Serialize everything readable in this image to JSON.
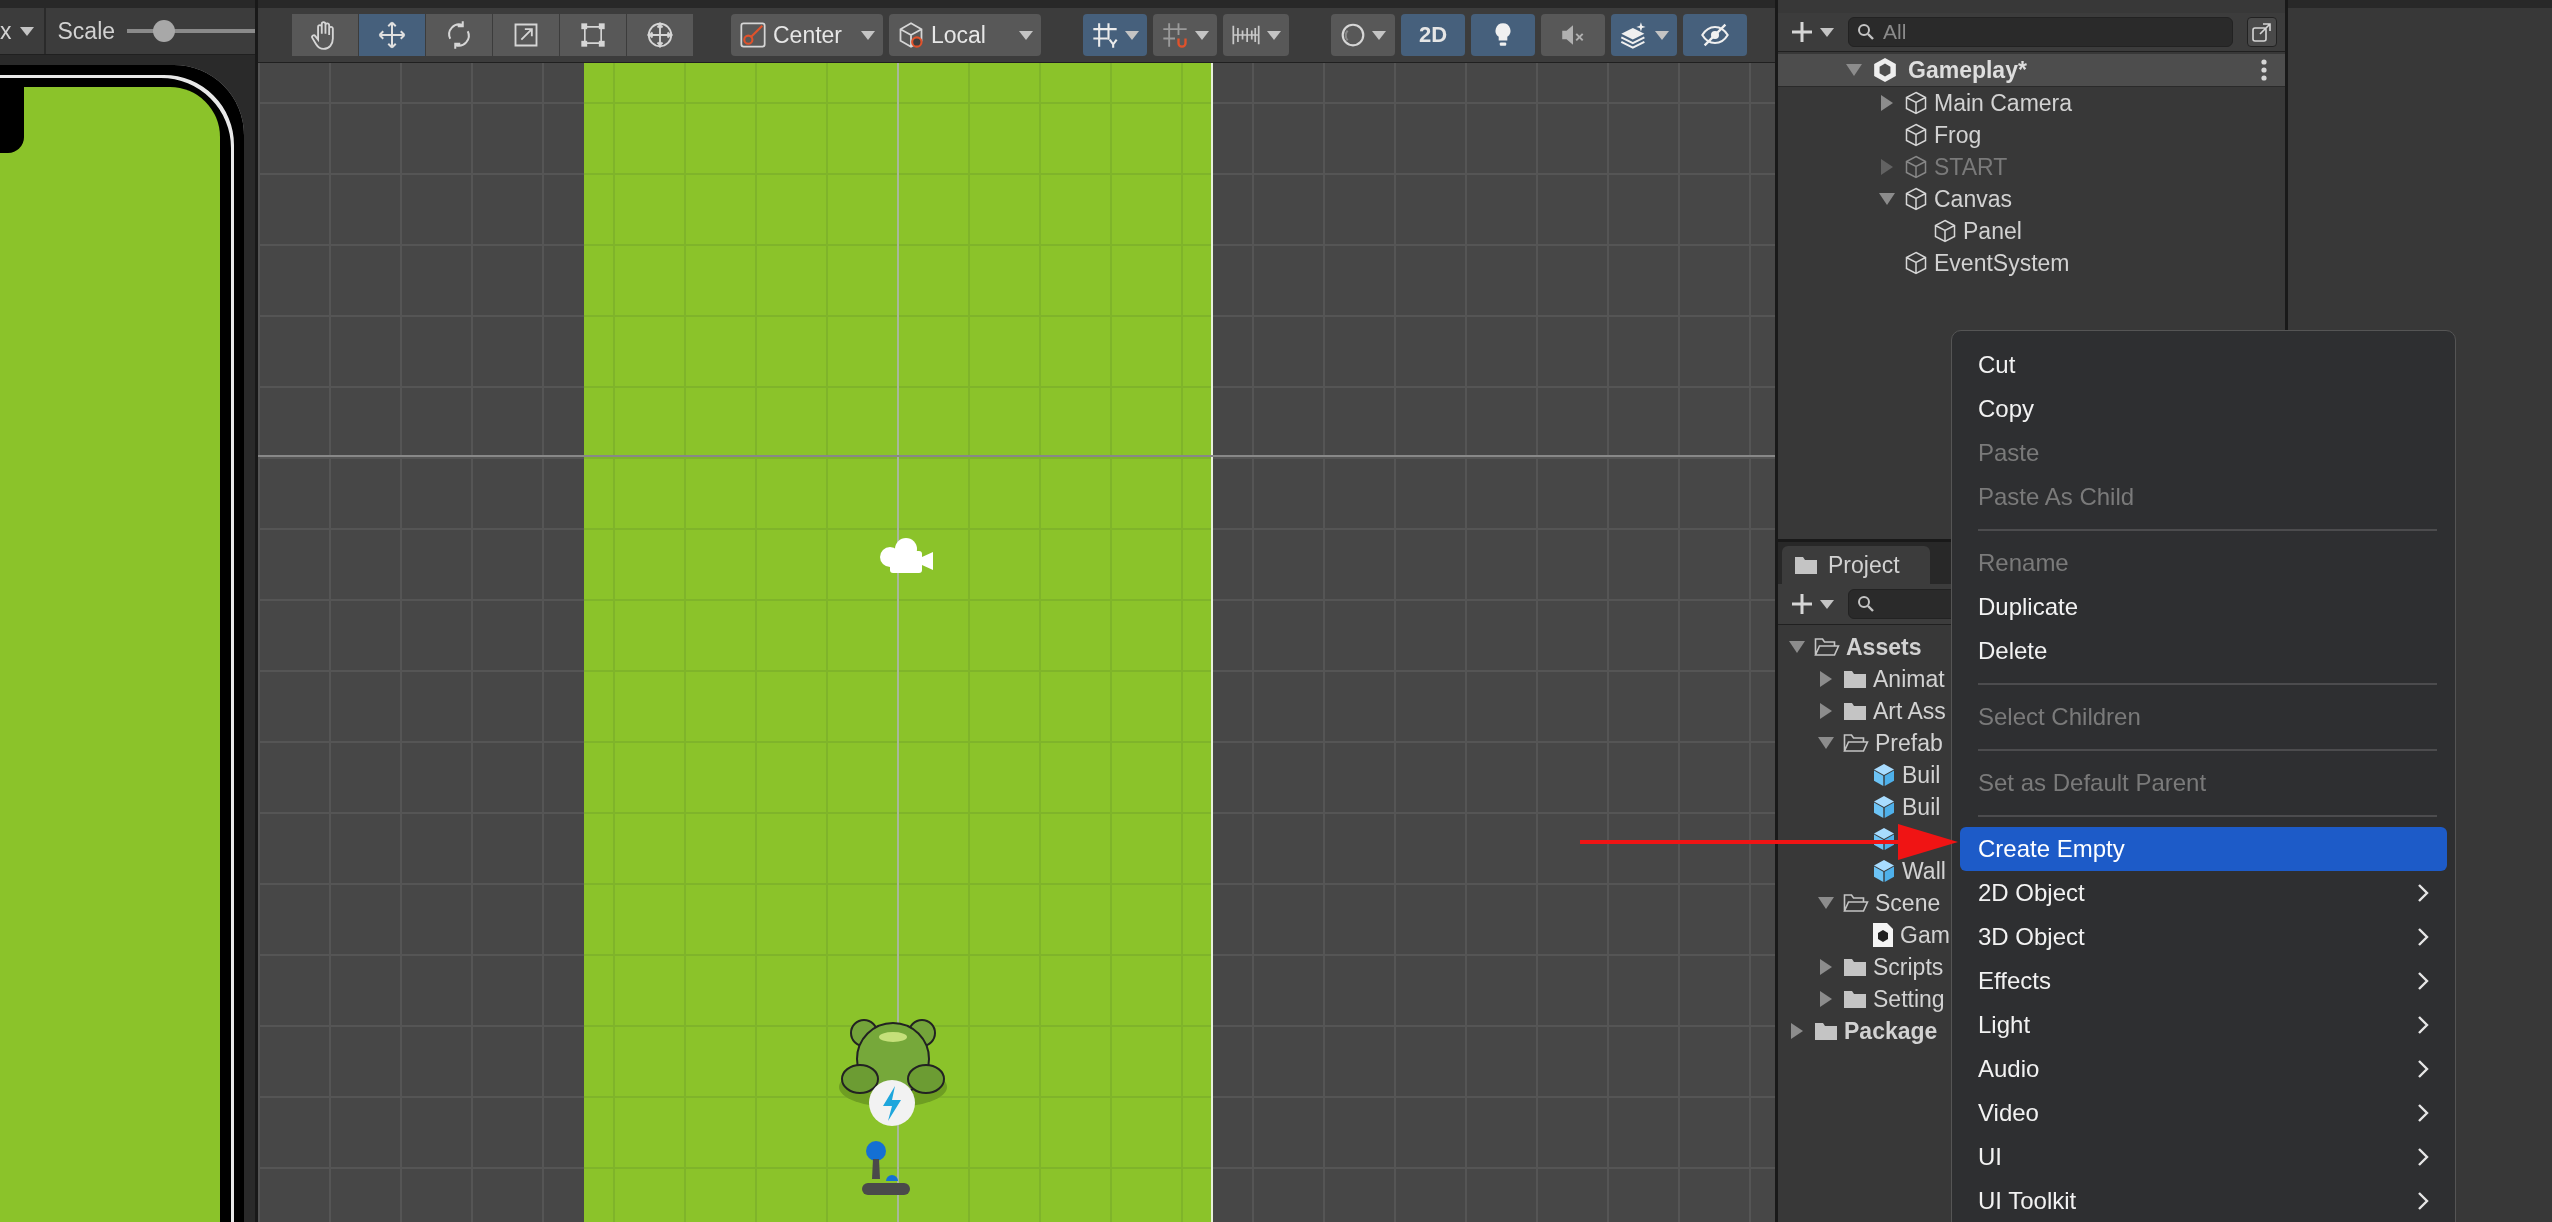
{
  "game_view": {
    "toolbar": {
      "aspect": "x",
      "scale_label": "Scale",
      "scale_slider": {
        "level": 0.28
      }
    }
  },
  "scene_view": {
    "toolbar": {
      "tools": [
        {
          "kind": "hand",
          "selected": false
        },
        {
          "kind": "move",
          "selected": true
        },
        {
          "kind": "rotate",
          "selected": false
        },
        {
          "kind": "scale",
          "selected": false
        },
        {
          "kind": "rect",
          "selected": false
        },
        {
          "kind": "transform",
          "selected": false
        }
      ],
      "pivot_mode": {
        "label": "Center"
      },
      "pivot_rotation": {
        "label": "Local"
      },
      "snap_toggles": [
        {
          "kind": "grid",
          "on": true,
          "dropdown": true
        },
        {
          "kind": "snap",
          "on": false,
          "dropdown": true
        },
        {
          "kind": "ruler",
          "on": false,
          "dropdown": true
        }
      ],
      "view_toggles": [
        {
          "kind": "shading",
          "on": false,
          "dropdown": true
        },
        {
          "kind": "text",
          "label": "2D",
          "on": true,
          "dropdown": false
        },
        {
          "kind": "light",
          "on": true,
          "dropdown": false
        },
        {
          "kind": "audio",
          "on": false,
          "dropdown": false
        },
        {
          "kind": "effects",
          "on": true,
          "dropdown": true
        },
        {
          "kind": "visibility",
          "on": true,
          "dropdown": false
        }
      ]
    }
  },
  "hierarchy": {
    "search": {
      "placeholder": "All"
    },
    "scene": {
      "name": "Gameplay*",
      "expanded": true
    },
    "items": [
      {
        "kind": "group",
        "name": "Main Camera",
        "expanded": false,
        "disabled": false
      },
      {
        "kind": "leaf",
        "name": "Frog",
        "disabled": false
      },
      {
        "kind": "group",
        "name": "START",
        "expanded": false,
        "disabled": true
      },
      {
        "kind": "group",
        "name": "Canvas",
        "expanded": true,
        "disabled": false,
        "children": [
          {
            "kind": "leaf",
            "name": "Panel",
            "disabled": false
          }
        ]
      },
      {
        "kind": "leaf",
        "name": "EventSystem",
        "disabled": false
      }
    ]
  },
  "project": {
    "tab": {
      "label": "Project",
      "selected": true
    },
    "tree": [
      {
        "kind": "folder",
        "name": "Assets",
        "expanded": true,
        "bold": true,
        "children": [
          {
            "kind": "folder",
            "name": "Animat",
            "expanded": false,
            "bold": false
          },
          {
            "kind": "folder",
            "name": "Art Ass",
            "expanded": false,
            "bold": false
          },
          {
            "kind": "folder",
            "name": "Prefab",
            "expanded": true,
            "bold": false,
            "children": [
              {
                "kind": "prefab",
                "name": "Buil"
              },
              {
                "kind": "prefab",
                "name": "Buil"
              },
              {
                "kind": "prefab"
              },
              {
                "kind": "prefab",
                "name": "Wall"
              }
            ]
          },
          {
            "kind": "folder",
            "name": "Scene",
            "expanded": true,
            "bold": false,
            "children": [
              {
                "kind": "scene",
                "name": "Gam"
              }
            ]
          },
          {
            "kind": "folder",
            "name": "Scripts",
            "expanded": false,
            "bold": false
          },
          {
            "kind": "folder",
            "name": "Setting",
            "expanded": false,
            "bold": false
          }
        ]
      },
      {
        "kind": "folder",
        "name": "Package",
        "expanded": false,
        "bold": true
      }
    ]
  },
  "context_menu": {
    "items": [
      {
        "kind": "item",
        "label": "Cut",
        "disabled": false,
        "selected": false,
        "submenu": false
      },
      {
        "kind": "item",
        "label": "Copy",
        "disabled": false,
        "selected": false,
        "submenu": false
      },
      {
        "kind": "item",
        "label": "Paste",
        "disabled": true,
        "selected": false,
        "submenu": false
      },
      {
        "kind": "item",
        "label": "Paste As Child",
        "disabled": true,
        "selected": false,
        "submenu": false
      },
      {
        "kind": "separator"
      },
      {
        "kind": "item",
        "label": "Rename",
        "disabled": true,
        "selected": false,
        "submenu": false
      },
      {
        "kind": "item",
        "label": "Duplicate",
        "disabled": false,
        "selected": false,
        "submenu": false
      },
      {
        "kind": "item",
        "label": "Delete",
        "disabled": false,
        "selected": false,
        "submenu": false
      },
      {
        "kind": "separator"
      },
      {
        "kind": "item",
        "label": "Select Children",
        "disabled": true,
        "selected": false,
        "submenu": false
      },
      {
        "kind": "separator"
      },
      {
        "kind": "item",
        "label": "Set as Default Parent",
        "disabled": true,
        "selected": false,
        "submenu": false
      },
      {
        "kind": "separator"
      },
      {
        "kind": "item",
        "label": "Create Empty",
        "disabled": false,
        "selected": true,
        "submenu": false
      },
      {
        "kind": "item",
        "label": "2D Object",
        "disabled": false,
        "selected": false,
        "submenu": true
      },
      {
        "kind": "item",
        "label": "3D Object",
        "disabled": false,
        "selected": false,
        "submenu": true
      },
      {
        "kind": "item",
        "label": "Effects",
        "disabled": false,
        "selected": false,
        "submenu": true
      },
      {
        "kind": "item",
        "label": "Light",
        "disabled": false,
        "selected": false,
        "submenu": true
      },
      {
        "kind": "item",
        "label": "Audio",
        "disabled": false,
        "selected": false,
        "submenu": true
      },
      {
        "kind": "item",
        "label": "Video",
        "disabled": false,
        "selected": false,
        "submenu": true
      },
      {
        "kind": "item",
        "label": "UI",
        "disabled": false,
        "selected": false,
        "submenu": true
      },
      {
        "kind": "item",
        "label": "UI Toolkit",
        "disabled": false,
        "selected": false,
        "submenu": true
      }
    ]
  }
}
